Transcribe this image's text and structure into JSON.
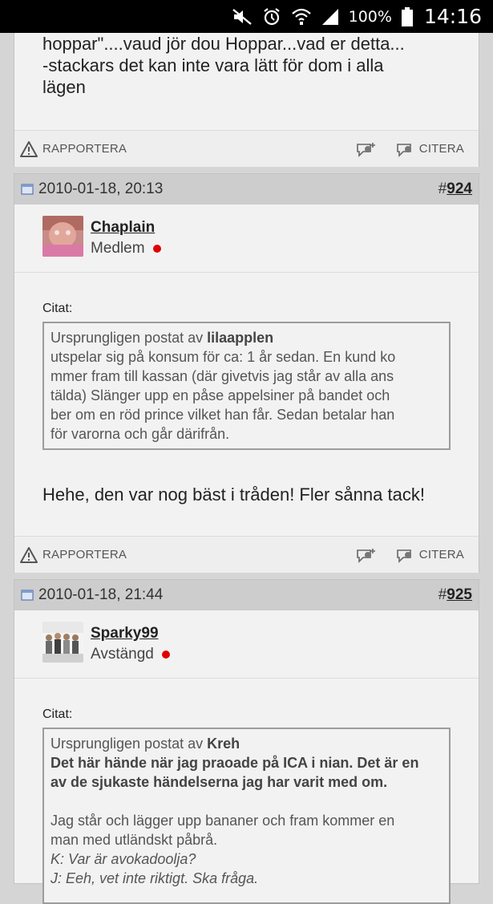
{
  "status_bar": {
    "battery_percent": "100%",
    "time": "14:16"
  },
  "posts": [
    {
      "tail_lines": [
        "hoppar\"....vaud jör dou Hoppar...vad er detta...",
        "-stackars det kan inte vara lätt för dom i alla",
        "lägen"
      ],
      "actions": {
        "report": "RAPPORTERA",
        "quote": "CITERA"
      }
    },
    {
      "date": "2010-01-18, 20:13",
      "hash": "#",
      "number": "924",
      "author": {
        "name": "Chaplain",
        "role": "Medlem",
        "online_color": "#e00000"
      },
      "citat_label": "Citat:",
      "quote": {
        "prefix": "Ursprungligen postat av ",
        "author": "lilaapplen",
        "lines": [
          "utspelar sig på konsum för ca: 1 år sedan. En kund ko",
          "mmer fram till kassan (där givetvis jag står av alla ans",
          "tälda) Slänger upp en påse appelsiner på bandet och",
          "ber om en röd prince vilket han får. Sedan betalar han",
          "för varorna och går därifrån."
        ]
      },
      "reply": "Hehe, den var nog bäst i tråden! Fler sånna tack!",
      "actions": {
        "report": "RAPPORTERA",
        "quote": "CITERA"
      }
    },
    {
      "date": "2010-01-18, 21:44",
      "hash": "#",
      "number": "925",
      "author": {
        "name": "Sparky99",
        "role": "Avstängd",
        "online_color": "#e00000"
      },
      "citat_label": "Citat:",
      "quote": {
        "prefix": "Ursprungligen postat av ",
        "author": "Kreh",
        "bold_lines": [
          "Det här hände när jag praoade på ICA i nian. Det är en",
          "av de sjukaste händelserna jag har varit med om."
        ],
        "lines": [
          "Jag står och lägger upp bananer och fram kommer en",
          "man med utländskt påbrå."
        ],
        "italic_lines": [
          "K: Var är avokadoolja?",
          "J: Eeh, vet inte riktigt. Ska fråga."
        ]
      }
    }
  ]
}
